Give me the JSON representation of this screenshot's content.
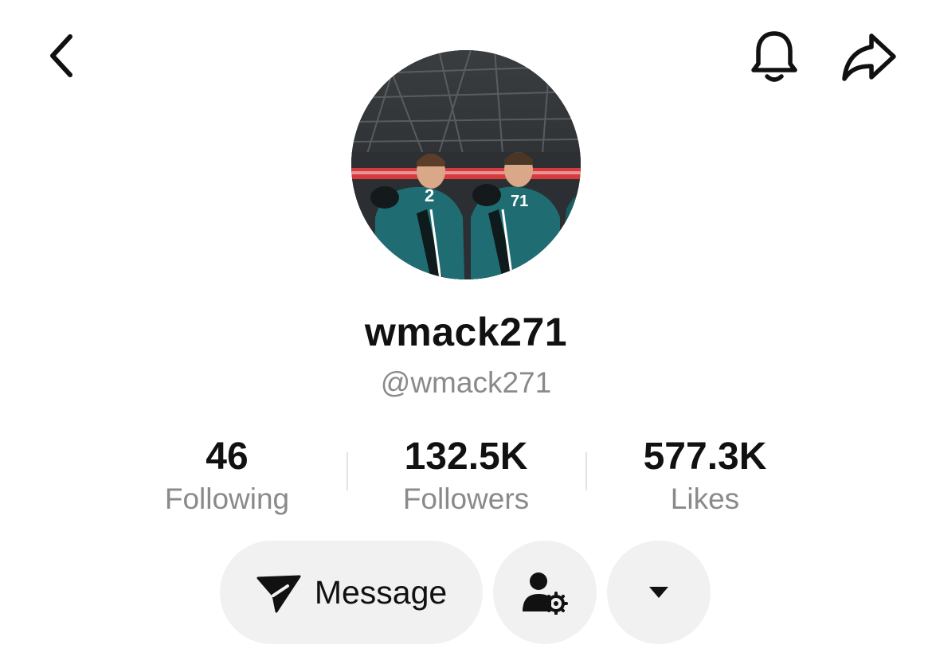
{
  "header": {
    "back_icon": "chevron-left-icon",
    "bell_icon": "bell-icon",
    "share_icon": "share-arrow-icon"
  },
  "profile": {
    "avatar_alt": "profile photo",
    "display_name": "wmack271",
    "handle": "@wmack271"
  },
  "stats": [
    {
      "value": "46",
      "label": "Following"
    },
    {
      "value": "132.5K",
      "label": "Followers"
    },
    {
      "value": "577.3K",
      "label": "Likes"
    }
  ],
  "actions": {
    "message_label": "Message",
    "message_icon": "send-icon",
    "friend_icon": "user-settings-icon",
    "more_icon": "caret-down-icon"
  },
  "colors": {
    "background": "#ffffff",
    "text_primary": "#111111",
    "text_secondary": "#8a8a8a",
    "button_bg": "#f1f1f1",
    "jersey_teal": "#1f6d72"
  }
}
